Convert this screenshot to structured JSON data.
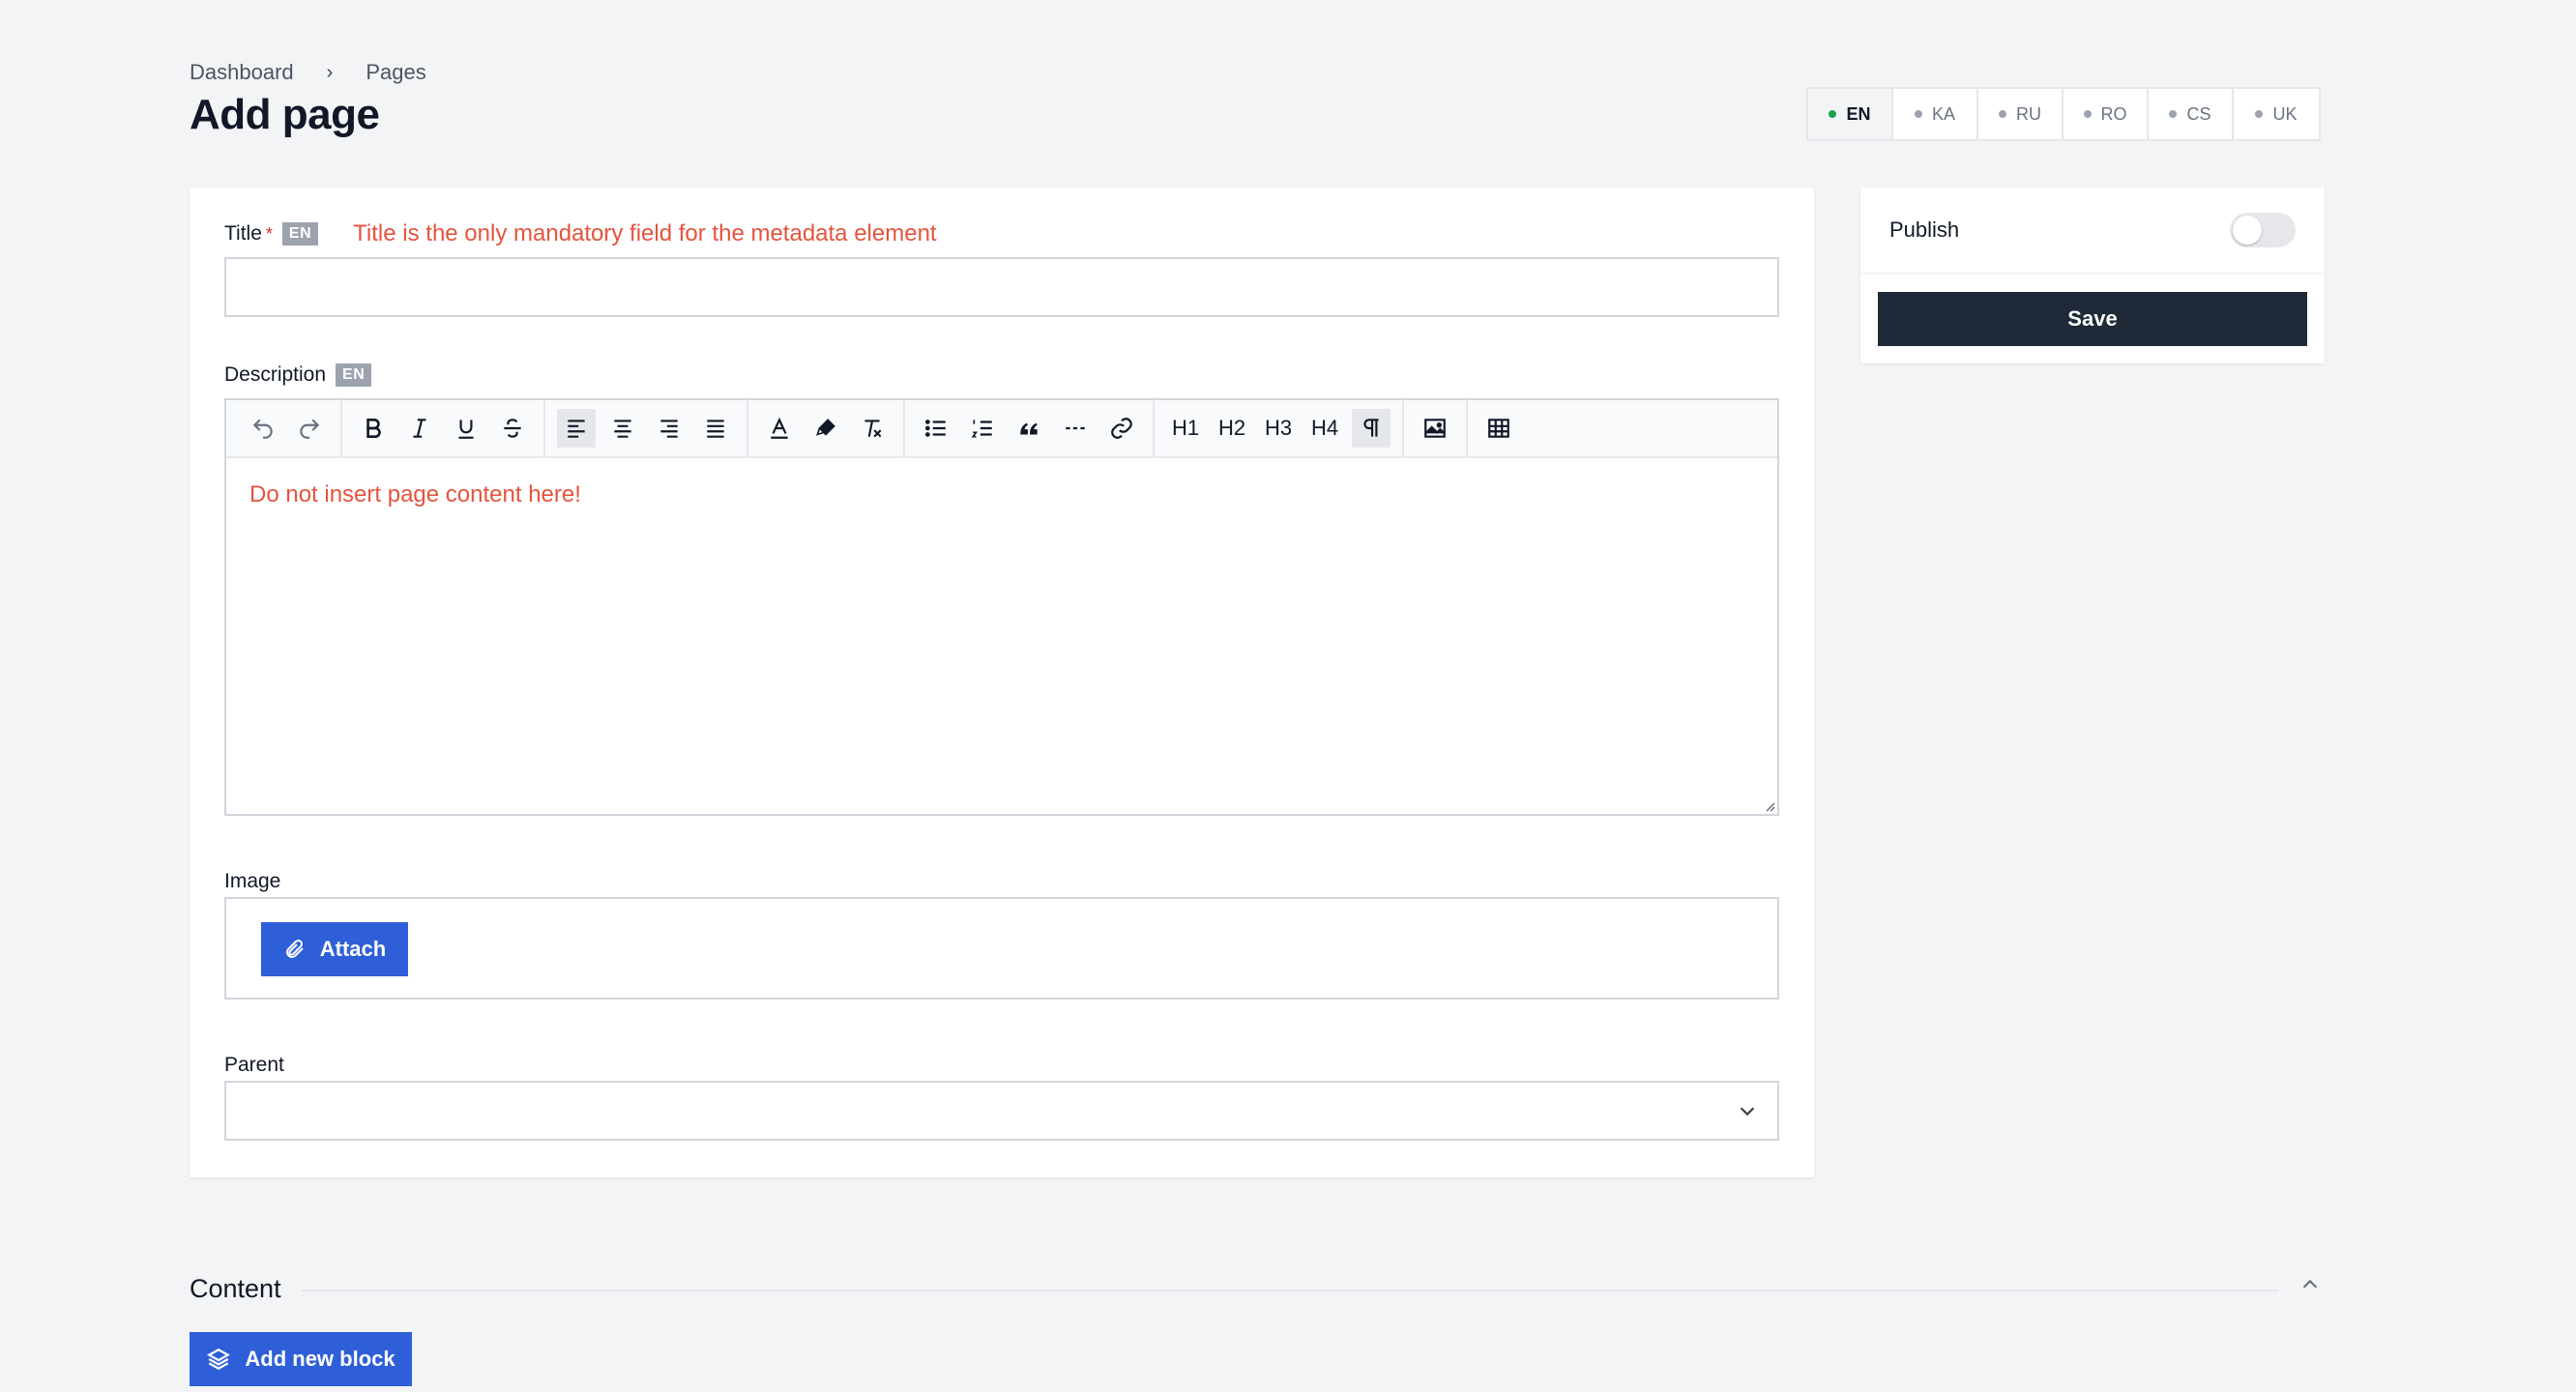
{
  "breadcrumb": {
    "items": [
      "Dashboard",
      "Pages"
    ],
    "separator": "›"
  },
  "page": {
    "title": "Add page"
  },
  "languages": [
    {
      "code": "EN",
      "active": true
    },
    {
      "code": "KA",
      "active": false
    },
    {
      "code": "RU",
      "active": false
    },
    {
      "code": "RO",
      "active": false
    },
    {
      "code": "CS",
      "active": false
    },
    {
      "code": "UK",
      "active": false
    }
  ],
  "form": {
    "title": {
      "label": "Title",
      "required_mark": "*",
      "lang_badge": "EN",
      "hint": "Title is the only mandatory field for the metadata element",
      "value": ""
    },
    "description": {
      "label": "Description",
      "lang_badge": "EN",
      "body_text": "Do not insert page content here!",
      "toolbar_headings": [
        "H1",
        "H2",
        "H3",
        "H4"
      ]
    },
    "image": {
      "label": "Image",
      "attach_label": "Attach"
    },
    "parent": {
      "label": "Parent",
      "value": ""
    }
  },
  "sidebar": {
    "publish_label": "Publish",
    "publish_on": false,
    "save_label": "Save"
  },
  "content": {
    "title": "Content",
    "add_block_label": "Add new block"
  },
  "colors": {
    "primary": "#2f5fd8",
    "dark": "#1f2937",
    "hint_red": "#e5533d",
    "active_dot": "#16a34a"
  }
}
